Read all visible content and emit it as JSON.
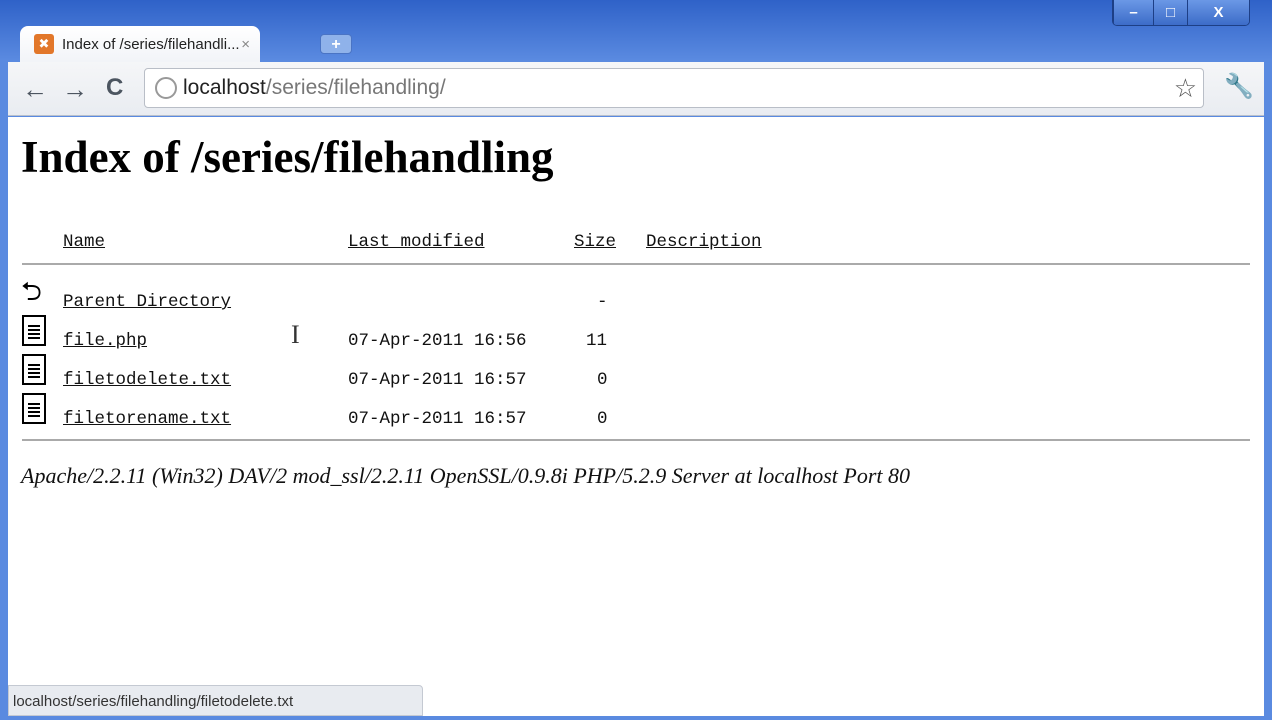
{
  "window": {
    "minimize": "–",
    "maximize": "□",
    "close": "X"
  },
  "tab": {
    "title": "Index of /series/filehandli...",
    "close": "×",
    "new_tab": "+"
  },
  "toolbar": {
    "back": "←",
    "forward": "→",
    "reload": "C",
    "url_host": "localhost",
    "url_path": "/series/filehandling/",
    "star": "☆",
    "wrench": "🔧"
  },
  "page": {
    "title": "Index of /series/filehandling",
    "headers": {
      "name": "Name",
      "modified": "Last modified",
      "size": "Size",
      "description": "Description"
    },
    "rows": [
      {
        "icon": "parent-directory-icon",
        "name": "Parent Directory",
        "modified": "",
        "size": "-"
      },
      {
        "icon": "file-icon",
        "name": "file.php",
        "modified": "07-Apr-2011 16:56",
        "size": "11"
      },
      {
        "icon": "file-icon",
        "name": "filetodelete.txt",
        "modified": "07-Apr-2011 16:57",
        "size": "0"
      },
      {
        "icon": "file-icon",
        "name": "filetorename.txt",
        "modified": "07-Apr-2011 16:57",
        "size": "0"
      }
    ],
    "address": "Apache/2.2.11 (Win32) DAV/2 mod_ssl/2.2.11 OpenSSL/0.9.8i PHP/5.2.9 Server at localhost Port 80"
  },
  "status_bar": "localhost/series/filehandling/filetodelete.txt"
}
